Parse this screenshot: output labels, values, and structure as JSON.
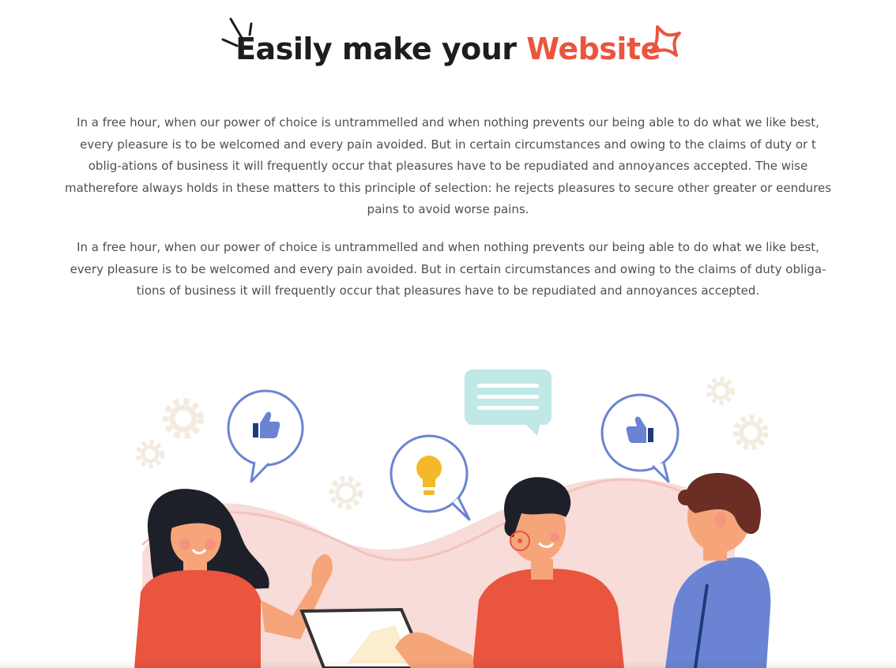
{
  "heading": {
    "text": "Easily make your",
    "accent": "Website",
    "accent_color": "#e9553e",
    "text_color": "#1d1d1d"
  },
  "paragraphs": [
    "In a free hour, when our power of choice is untrammelled and when nothing prevents our being able to do what we like best, every pleasure is to be welcomed and every pain avoided. But in certain circumstances and owing to the claims of duty or t oblig-ations of business it will frequently occur that pleasures have to be repudiated and annoyances accepted. The wise matherefore always holds in these matters to this principle of selection: he rejects pleasures to secure other greater or eendures pains to avoid worse pains.",
    "In a free hour, when our power of choice is untrammelled and when nothing prevents our being able to do what we like best, every pleasure is to be welcomed and every pain avoided. But in certain circumstances and owing to the claims of duty obliga-tions of business it will frequently occur that pleasures have to be repudiated and annoyances accepted."
  ],
  "illustration": {
    "icons": [
      "thumbs-up-icon",
      "lightbulb-icon",
      "chat-message-icon",
      "thumbs-up-icon",
      "gear-icon"
    ],
    "colors": {
      "bubble_outline": "#6a84d3",
      "shirt_orange": "#e9553e",
      "shirt_blue": "#6a84d3",
      "skin": "#f6a57b",
      "hair_dark": "#1e2029",
      "hair_brown": "#6a2e24",
      "bulb": "#f4b82a",
      "chat_bubble": "#bfe8e6",
      "wave": "#f8dcd9",
      "gear": "#f3ebe0"
    }
  }
}
